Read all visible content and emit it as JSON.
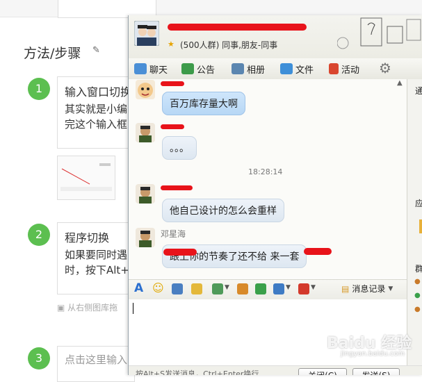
{
  "article": {
    "section_title": "方法/步骤",
    "steps": [
      {
        "number": "1",
        "title": "输入窗口切换",
        "line1": "其实就是小编",
        "line2": "完这个输入框"
      },
      {
        "number": "2",
        "title": "程序切换",
        "line1": "如果要同时遇",
        "line2": "时，按下Alt+"
      },
      {
        "number": "3",
        "placeholder": "点击这里输入"
      }
    ],
    "drag_hint": "从右侧图库拖"
  },
  "qq": {
    "group_info": "(500人群) 同事,朋友-同事",
    "tabs": [
      "聊天",
      "公告",
      "相册",
      "文件",
      "活动"
    ],
    "messages": [
      {
        "text": "百万库存量大啊"
      },
      {
        "text": "。。。"
      },
      {
        "timestamp": "18:28:14"
      },
      {
        "text": "他自己设计的怎么会重样"
      },
      {
        "sender": "邓星海",
        "text": "跟上你的节奏了还不给 来一套"
      }
    ],
    "msg_record_label": "消息记录",
    "bottom_text": "按Alt+S发送消息，Ctrl+Enter换行",
    "buttons": {
      "close": "关闭(C)",
      "send": "发送(S)"
    },
    "right_pane": [
      "通",
      "应",
      "群"
    ]
  },
  "watermark": {
    "main": "Baidu 经验",
    "sub": "jingyan.baidu.com"
  }
}
